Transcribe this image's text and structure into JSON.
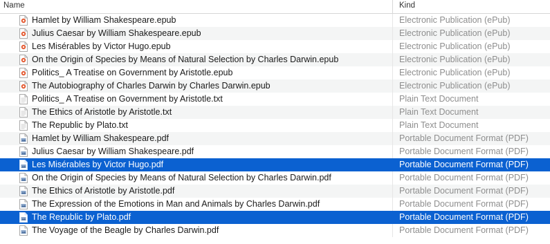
{
  "header": {
    "name": "Name",
    "kind": "Kind"
  },
  "colors": {
    "selection": "#0b61d1",
    "alt_row": "#f4f5f5",
    "kind_text": "#8e8e8e",
    "epub_badge": "#e4572e"
  },
  "files": [
    {
      "name": "Hamlet by William Shakespeare.epub",
      "kind": "Electronic Publication (ePub)",
      "icon": "epub-icon",
      "selected": false
    },
    {
      "name": "Julius Caesar by William Shakespeare.epub",
      "kind": "Electronic Publication (ePub)",
      "icon": "epub-icon",
      "selected": false
    },
    {
      "name": "Les Misérables by Victor Hugo.epub",
      "kind": "Electronic Publication (ePub)",
      "icon": "epub-icon",
      "selected": false
    },
    {
      "name": "On the Origin of Species by Means of Natural Selection by Charles Darwin.epub",
      "kind": "Electronic Publication (ePub)",
      "icon": "epub-icon",
      "selected": false
    },
    {
      "name": "Politics_ A Treatise on Government by Aristotle.epub",
      "kind": "Electronic Publication (ePub)",
      "icon": "epub-icon",
      "selected": false
    },
    {
      "name": "The Autobiography of Charles Darwin by Charles Darwin.epub",
      "kind": "Electronic Publication (ePub)",
      "icon": "epub-icon",
      "selected": false
    },
    {
      "name": "Politics_ A Treatise on Government by Aristotle.txt",
      "kind": "Plain Text Document",
      "icon": "text-file-icon",
      "selected": false
    },
    {
      "name": "The Ethics of Aristotle by Aristotle.txt",
      "kind": "Plain Text Document",
      "icon": "text-file-icon",
      "selected": false
    },
    {
      "name": "The Republic by Plato.txt",
      "kind": "Plain Text Document",
      "icon": "text-file-icon",
      "selected": false
    },
    {
      "name": "Hamlet by William Shakespeare.pdf",
      "kind": "Portable Document Format (PDF)",
      "icon": "pdf-icon",
      "selected": false
    },
    {
      "name": "Julius Caesar by William Shakespeare.pdf",
      "kind": "Portable Document Format (PDF)",
      "icon": "pdf-icon",
      "selected": false
    },
    {
      "name": "Les Misérables by Victor Hugo.pdf",
      "kind": "Portable Document Format (PDF)",
      "icon": "pdf-icon",
      "selected": true
    },
    {
      "name": "On the Origin of Species by Means of Natural Selection by Charles Darwin.pdf",
      "kind": "Portable Document Format (PDF)",
      "icon": "pdf-icon",
      "selected": false
    },
    {
      "name": "The Ethics of Aristotle by Aristotle.pdf",
      "kind": "Portable Document Format (PDF)",
      "icon": "pdf-icon",
      "selected": false
    },
    {
      "name": "The Expression of the Emotions in Man and Animals by Charles Darwin.pdf",
      "kind": "Portable Document Format (PDF)",
      "icon": "pdf-icon",
      "selected": false
    },
    {
      "name": "The Republic by Plato.pdf",
      "kind": "Portable Document Format (PDF)",
      "icon": "pdf-icon",
      "selected": true
    },
    {
      "name": "The Voyage of the Beagle by Charles Darwin.pdf",
      "kind": "Portable Document Format (PDF)",
      "icon": "pdf-icon",
      "selected": false
    }
  ]
}
